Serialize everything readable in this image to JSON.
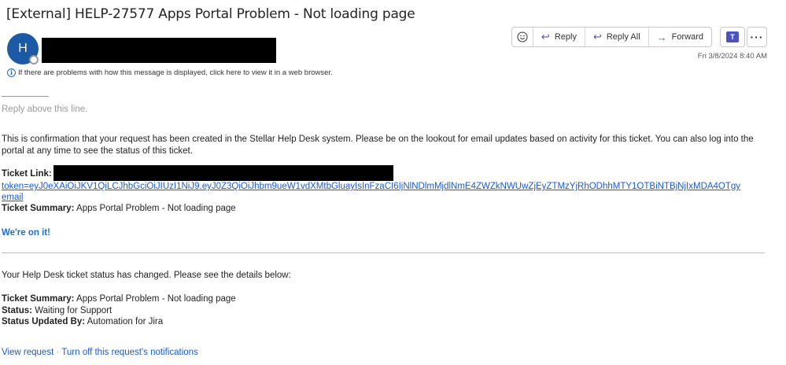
{
  "email": {
    "subject": "[External] HELP-27577 Apps Portal Problem - Not loading page",
    "avatar_initial": "H",
    "info_line": "If there are problems with how this message is displayed, click here to view it in a web browser.",
    "date": "Fri 3/8/2024 8:40 AM"
  },
  "toolbar": {
    "reply": "Reply",
    "reply_all": "Reply All",
    "forward": "Forward",
    "teams_icon": "T"
  },
  "body": {
    "reply_above": "Reply above this line.",
    "confirmation": "This is confirmation that your request has been created in the Stellar Help Desk system. Please be on the lookout for email updates based on activity for this ticket. You can also log into the portal at any time to see the status of this ticket.",
    "ticket_link_label": "Ticket Link:",
    "token_line": "token=eyJ0eXAiOiJKV1QiLCJhbGciOiJIUzI1NiJ9.eyJ0Z3QiOiJhbm9ueW1vdXMtbGluayIsInFzaCI6IjNlNDlmMjdlNmE4ZWZkNWUwZjEyZTMzYjRhODhhMTY1OTBiNTBjNjIxMDA4OTgy",
    "token_line2": "email",
    "summary_label": "Ticket Summary:",
    "summary_value": "Apps Portal Problem - Not loading page",
    "on_it": "We're on it!",
    "status_changed": "Your Help Desk ticket status has changed. Please see the details below:",
    "summary2_label": "Ticket Summary:",
    "summary2_value": "Apps Portal Problem - Not loading page",
    "status_label": "Status:",
    "status_value": "Waiting for Support",
    "updated_by_label": "Status Updated By:",
    "updated_by_value": "Automation for Jira",
    "view_request": "View request",
    "separator": " · ",
    "turn_off": "Turn off this request's notifications"
  }
}
